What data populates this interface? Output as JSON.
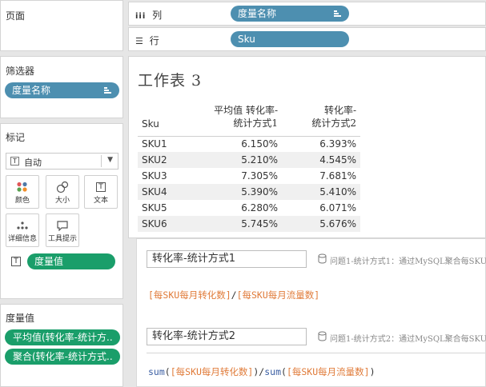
{
  "pages_panel": {
    "title": "页面"
  },
  "filters_panel": {
    "title": "筛选器",
    "pill": "度量名称"
  },
  "marks_panel": {
    "title": "标记",
    "mark_type": "自动",
    "cards": [
      {
        "label": "颜色"
      },
      {
        "label": "大小"
      },
      {
        "label": "文本"
      },
      {
        "label": "详细信息"
      },
      {
        "label": "工具提示"
      }
    ],
    "text_pill": "度量值"
  },
  "measures_panel": {
    "title": "度量值",
    "pills": [
      "平均值(转化率-统计方..",
      "聚合(转化率-统计方式.."
    ]
  },
  "columns_shelf": {
    "label": "列",
    "pill": "度量名称"
  },
  "rows_shelf": {
    "label": "行",
    "pill": "Sku"
  },
  "worksheet": {
    "title": "工作表 3",
    "headers": {
      "sku": "Sku",
      "col1_line1": "平均值 转化率-",
      "col1_line2": "统计方式1",
      "col2_line1": "转化率-",
      "col2_line2": "统计方式2"
    },
    "rows": [
      {
        "sku": "SKU1",
        "v1": "6.150%",
        "v2": "6.393%"
      },
      {
        "sku": "SKU2",
        "v1": "5.210%",
        "v2": "4.545%"
      },
      {
        "sku": "SKU3",
        "v1": "7.305%",
        "v2": "7.681%"
      },
      {
        "sku": "SKU4",
        "v1": "5.390%",
        "v2": "5.410%"
      },
      {
        "sku": "SKU5",
        "v1": "6.280%",
        "v2": "6.071%"
      },
      {
        "sku": "SKU6",
        "v1": "5.745%",
        "v2": "5.676%"
      }
    ]
  },
  "calc1": {
    "name": "转化率-统计方式1",
    "comment": "问题1-统计方式1：通过MySQL聚合每SKU",
    "f_field1": "[每SKU每月转化数]",
    "f_op": "/",
    "f_field2": "[每SKU每月流量数]"
  },
  "calc2": {
    "name": "转化率-统计方式2",
    "comment": "问题1-统计方式2：通过MySQL聚合每SKU",
    "f_fn1": "sum",
    "f_p1": "(",
    "f_field1": "[每SKU每月转化数]",
    "f_p2": ")",
    "f_op": "/",
    "f_fn2": "sum",
    "f_p3": "(",
    "f_field2": "[每SKU每月流量数]",
    "f_p4": ")"
  },
  "colors": {
    "dimension_pill": "#4d8fb0",
    "measure_pill": "#1a9e6a",
    "field_ref": "#e07b39",
    "function": "#3b5fa3"
  }
}
